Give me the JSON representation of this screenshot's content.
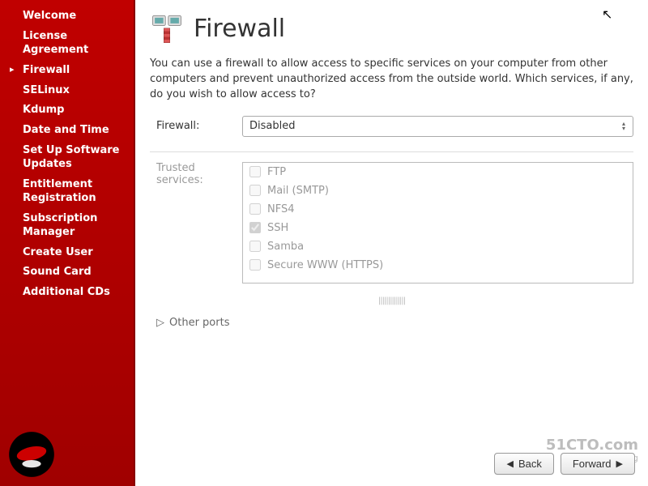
{
  "sidebar": {
    "items": [
      {
        "label": "Welcome",
        "active": false
      },
      {
        "label": "License Agreement",
        "active": false
      },
      {
        "label": "Firewall",
        "active": true
      },
      {
        "label": "SELinux",
        "active": false
      },
      {
        "label": "Kdump",
        "active": false
      },
      {
        "label": "Date and Time",
        "active": false
      },
      {
        "label": "Set Up Software Updates",
        "active": false
      },
      {
        "label": "Entitlement Registration",
        "active": false
      },
      {
        "label": "Subscription Manager",
        "active": false
      },
      {
        "label": "Create User",
        "active": false
      },
      {
        "label": "Sound Card",
        "active": false
      },
      {
        "label": "Additional CDs",
        "active": false
      }
    ]
  },
  "main": {
    "title": "Firewall",
    "description": "You can use a firewall to allow access to specific services on your computer from other computers and prevent unauthorized access from the outside world.  Which services, if any, do you wish to allow access to?",
    "firewall_label": "Firewall:",
    "firewall_value": "Disabled",
    "trusted_label": "Trusted services:",
    "services": [
      {
        "label": "FTP",
        "checked": false
      },
      {
        "label": "Mail (SMTP)",
        "checked": false
      },
      {
        "label": "NFS4",
        "checked": false
      },
      {
        "label": "SSH",
        "checked": true
      },
      {
        "label": "Samba",
        "checked": false
      },
      {
        "label": "Secure WWW (HTTPS)",
        "checked": false
      }
    ],
    "other_ports_label": "Other ports"
  },
  "footer": {
    "back_label": "Back",
    "forward_label": "Forward"
  },
  "watermark": {
    "main": "51CTO.com",
    "sub": "技术博客 Blog"
  }
}
